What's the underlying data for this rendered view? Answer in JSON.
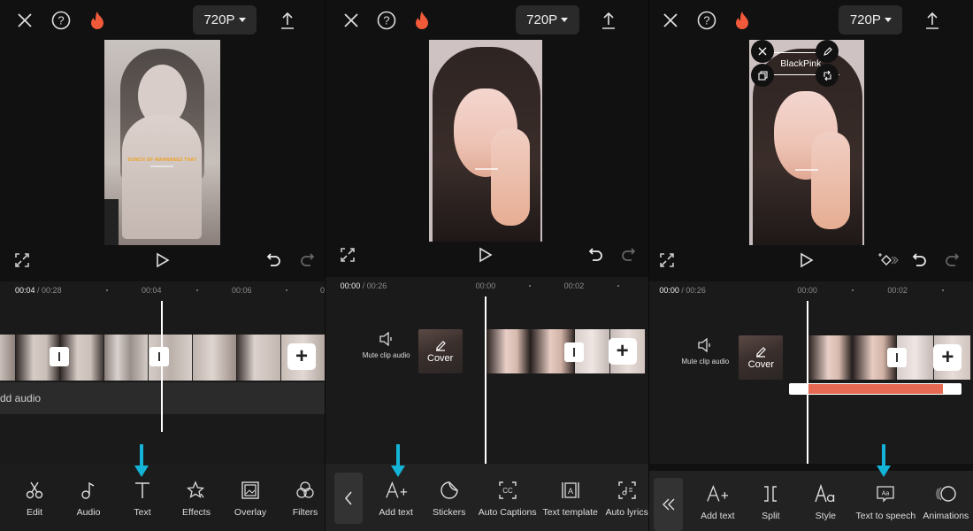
{
  "colors": {
    "accent_arrow": "#14b4d8",
    "flame": "#f05a3a",
    "tts_bar": "#e66a53",
    "bg": "#111111",
    "toolbar_bg": "#222222"
  },
  "panels": [
    {
      "topbar": {
        "resolution": "720P"
      },
      "timeline": {
        "current_time": "00:04",
        "total_time": "/ 00:28",
        "ticks": [
          "00:04",
          "00:06",
          "0"
        ],
        "add_audio_label": "dd audio"
      },
      "preview_caption": "DUNCH OF WANNABES THAT",
      "toolbar": {
        "items": [
          {
            "label": "Edit",
            "icon": "scissors-icon"
          },
          {
            "label": "Audio",
            "icon": "music-note-icon"
          },
          {
            "label": "Text",
            "icon": "text-icon"
          },
          {
            "label": "Effects",
            "icon": "effects-star-icon"
          },
          {
            "label": "Overlay",
            "icon": "overlay-icon"
          },
          {
            "label": "Filters",
            "icon": "filters-icon"
          }
        ],
        "highlighted": "Text"
      }
    },
    {
      "topbar": {
        "resolution": "720P"
      },
      "timeline": {
        "current_time": "00:00",
        "total_time": "/ 00:26",
        "ticks": [
          "00:00",
          "00:02"
        ],
        "mute_label": "Mute clip audio",
        "cover_label": "Cover"
      },
      "toolbar": {
        "items": [
          {
            "label": "Add text",
            "icon": "add-text-icon"
          },
          {
            "label": "Stickers",
            "icon": "sticker-icon"
          },
          {
            "label": "Auto Captions",
            "icon": "captions-icon"
          },
          {
            "label": "Text template",
            "icon": "text-template-icon"
          },
          {
            "label": "Auto lyrics",
            "icon": "lyrics-icon"
          }
        ],
        "highlighted": "Add text"
      }
    },
    {
      "topbar": {
        "resolution": "720P"
      },
      "text_overlay": "BlackPink",
      "timeline": {
        "current_time": "00:00",
        "total_time": "/ 00:26",
        "ticks": [
          "00:00",
          "00:02"
        ],
        "mute_label": "Mute clip audio",
        "cover_label": "Cover"
      },
      "toolbar": {
        "items": [
          {
            "label": "Add text",
            "icon": "add-text-icon"
          },
          {
            "label": "Split",
            "icon": "split-icon"
          },
          {
            "label": "Style",
            "icon": "style-icon"
          },
          {
            "label": "Text to speech",
            "icon": "text-to-speech-icon"
          },
          {
            "label": "Animations",
            "icon": "animations-icon"
          }
        ],
        "highlighted": "Text to speech"
      }
    }
  ]
}
